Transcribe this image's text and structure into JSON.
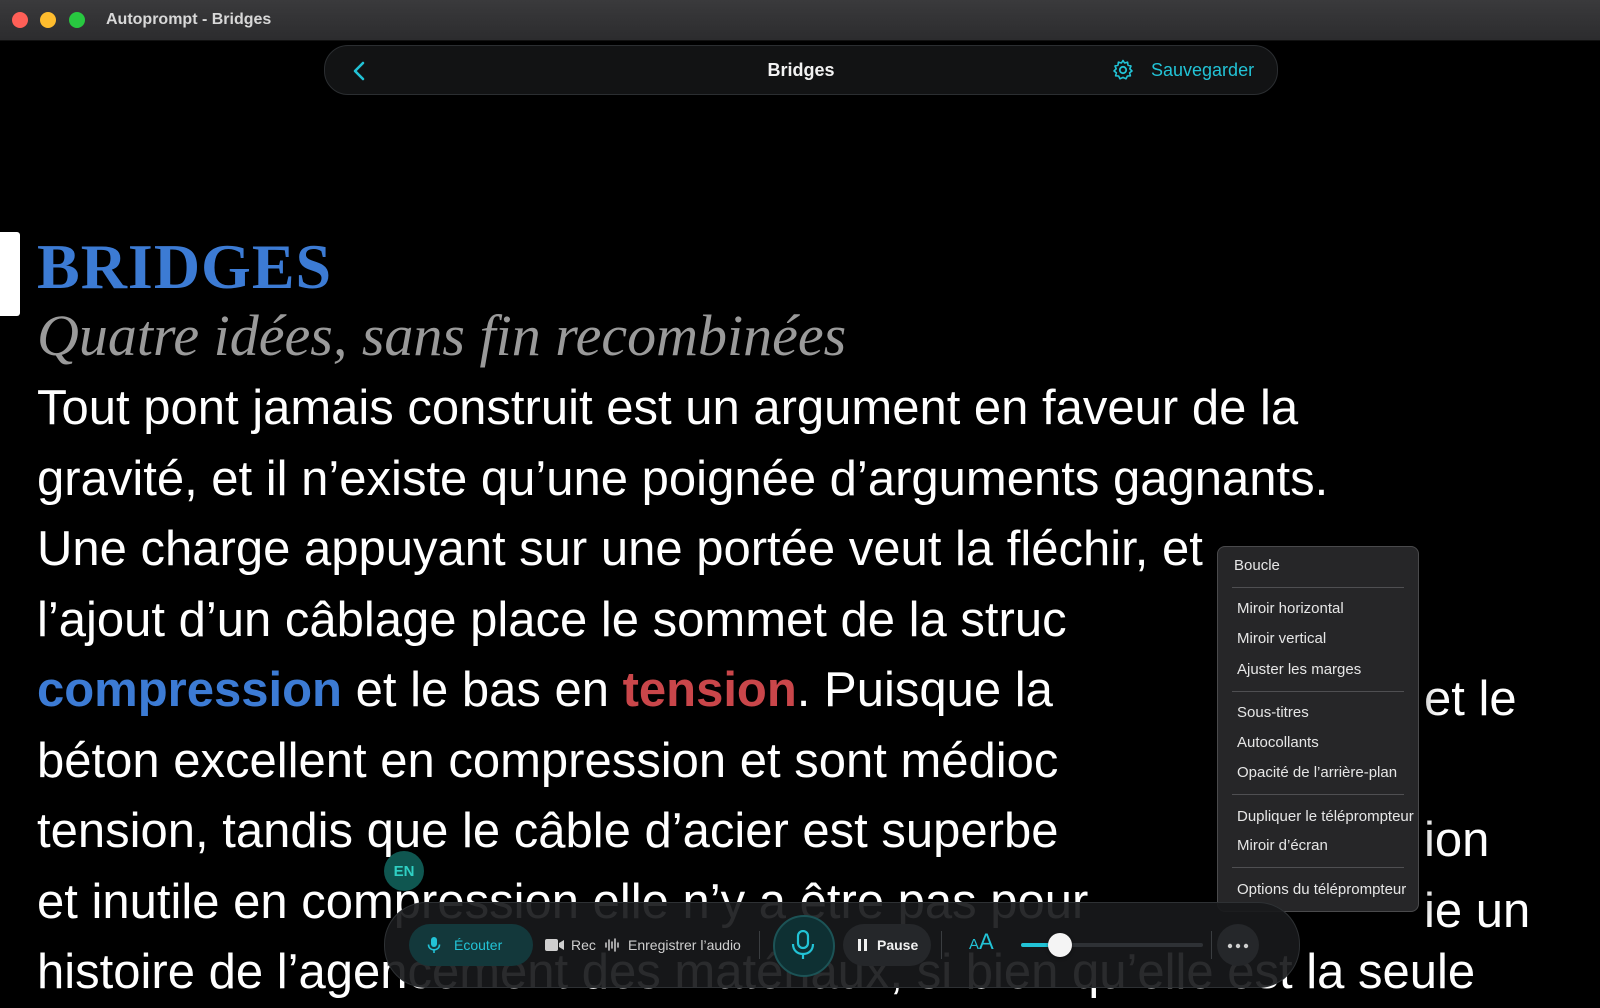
{
  "window": {
    "title": "Autoprompt - Bridges"
  },
  "topbar": {
    "back_icon": "chevron-left-icon",
    "title": "Bridges",
    "settings_icon": "gear-icon",
    "save_label": "Sauvegarder",
    "accent_color": "#22c3d6"
  },
  "script": {
    "title": "BRIDGES",
    "subtitle": "Quatre idées, sans fin recombinées",
    "lines": [
      "Tout pont jamais construit est un argument en faveur de la",
      "gravité, et il n’existe qu’une poignée d’arguments gagnants.",
      "Une charge appuyant sur une portée veut la fléchir, et",
      "l’ajout d’un câblage place le sommet de la struc",
      {
        "kw1": "compression",
        "mid": " et le bas en ",
        "kw2": "tension",
        "end": ". Puisque la"
      },
      "béton excellent en compression et sont médioc",
      "tension, tandis que le câble d’acier est superbe",
      "et inutile en compression elle n’y a être pas pour",
      "histoire de l’agencement des matériaux, si bien qu’elle est la seule"
    ],
    "overflow_right": [
      "",
      "",
      "",
      "",
      "et le",
      "",
      "ion",
      "ie un",
      ""
    ],
    "colors": {
      "title": "#3c7bd4",
      "subtitle": "#9a9a9a",
      "compression": "#3c7bd4",
      "tension": "#c9464a"
    }
  },
  "language_chip": "EN",
  "menu": {
    "items": [
      "Boucle",
      "Miroir horizontal",
      "Miroir vertical",
      "Ajuster les marges",
      "Sous-titres",
      "Autocollants",
      "Opacité de l’arrière-plan",
      "Dupliquer le téléprompteur",
      "Miroir d’écran",
      "Options du téléprompteur"
    ]
  },
  "controls": {
    "listen_label": "Écouter",
    "rec_label": "Rec",
    "record_audio_label": "Enregistrer l’audio",
    "pause_label": "Pause",
    "font_size_small": "A",
    "font_size_big": "A",
    "speed_fraction": 0.15,
    "icons": [
      "mic-icon",
      "camera-icon",
      "waveform-icon",
      "mic-icon",
      "pause-icon",
      "font-size-icon",
      "more-icon"
    ]
  }
}
